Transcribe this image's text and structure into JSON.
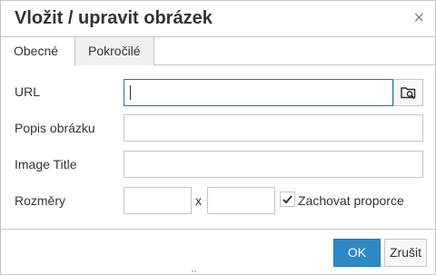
{
  "dialog": {
    "title": "Vložit / upravit obrázek",
    "close_symbol": "×"
  },
  "tabs": [
    {
      "label": "Obecné",
      "active": true
    },
    {
      "label": "Pokročilé",
      "active": false
    }
  ],
  "form": {
    "url_label": "URL",
    "url_value": "",
    "description_label": "Popis obrázku",
    "description_value": "",
    "image_title_label": "Image Title",
    "image_title_value": "",
    "dimensions_label": "Rozměry",
    "width_value": "",
    "height_value": "",
    "dimension_separator": "x",
    "keep_proportions_label": "Zachovat proporce",
    "keep_proportions_checked": true
  },
  "buttons": {
    "ok_label": "OK",
    "cancel_label": "Zrušit"
  },
  "icons": {
    "browse": "folder-search-icon",
    "close": "close-icon",
    "check": "checkmark-icon"
  },
  "colors": {
    "accent": "#2d8ac7",
    "focus_border": "#2276a8",
    "border": "#c5c5c5"
  }
}
